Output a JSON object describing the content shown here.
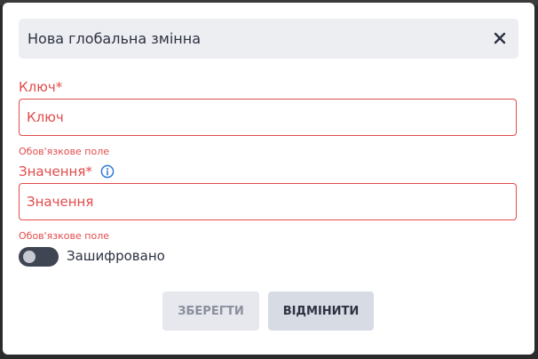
{
  "dialog": {
    "title": "Нова глобальна змінна",
    "close_icon": "close-icon"
  },
  "fields": {
    "key": {
      "label": "Ключ*",
      "placeholder": "Ключ",
      "value": "",
      "error": "Обов'язкове поле"
    },
    "value": {
      "label": "Значення*",
      "placeholder": "Значення",
      "value": "",
      "error": "Обов'язкове поле",
      "info_icon": "info-icon"
    }
  },
  "encrypted_toggle": {
    "label": "Зашифровано",
    "checked": false
  },
  "buttons": {
    "save_label": "ЗБЕРЕГТИ",
    "cancel_label": "ВІДМІНИТИ"
  },
  "colors": {
    "error": "#e34b4b",
    "header_bg": "#eceef2",
    "toggle_off": "#3f4552",
    "info_accent": "#2f7bd6"
  }
}
